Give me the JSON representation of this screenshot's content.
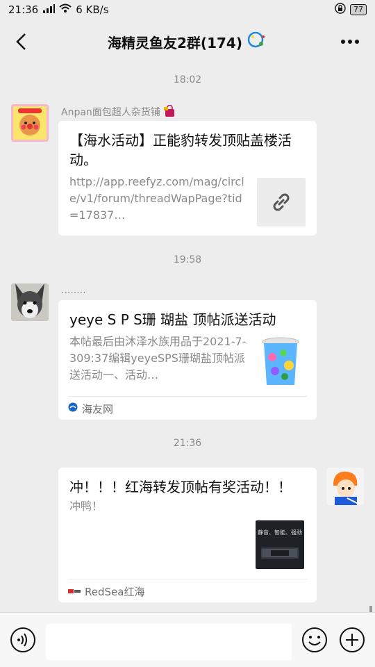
{
  "status": {
    "time": "21:36",
    "network": "6 KB/s",
    "battery": "77"
  },
  "header": {
    "title": "海精灵鱼友2群(174)"
  },
  "messages": [
    {
      "time": "18:02",
      "sender": "Anpan面包超人杂货铺",
      "title": "【海水活动】正能豹转发顶贴盖楼活动。",
      "desc": "http://app.reefyz.com/mag/circle/v1/forum/threadWapPage?tid=17837…"
    },
    {
      "time": "19:58",
      "sender": "........",
      "title": "yeye S P S珊 瑚盐 顶帖派送活动",
      "desc": "本帖最后由沐泽水族用品于2021-7-309:37编辑yeyeSPS珊瑚盐顶帖派送活动一、活动…",
      "source": "海友网"
    },
    {
      "time": "21:36",
      "title": "冲！！！红海转发顶帖有奖活动！！",
      "desc": "冲鸭！",
      "source": "RedSea红海",
      "thumb_text": "静音、智能、强劲"
    }
  ],
  "input": {
    "value": ""
  }
}
